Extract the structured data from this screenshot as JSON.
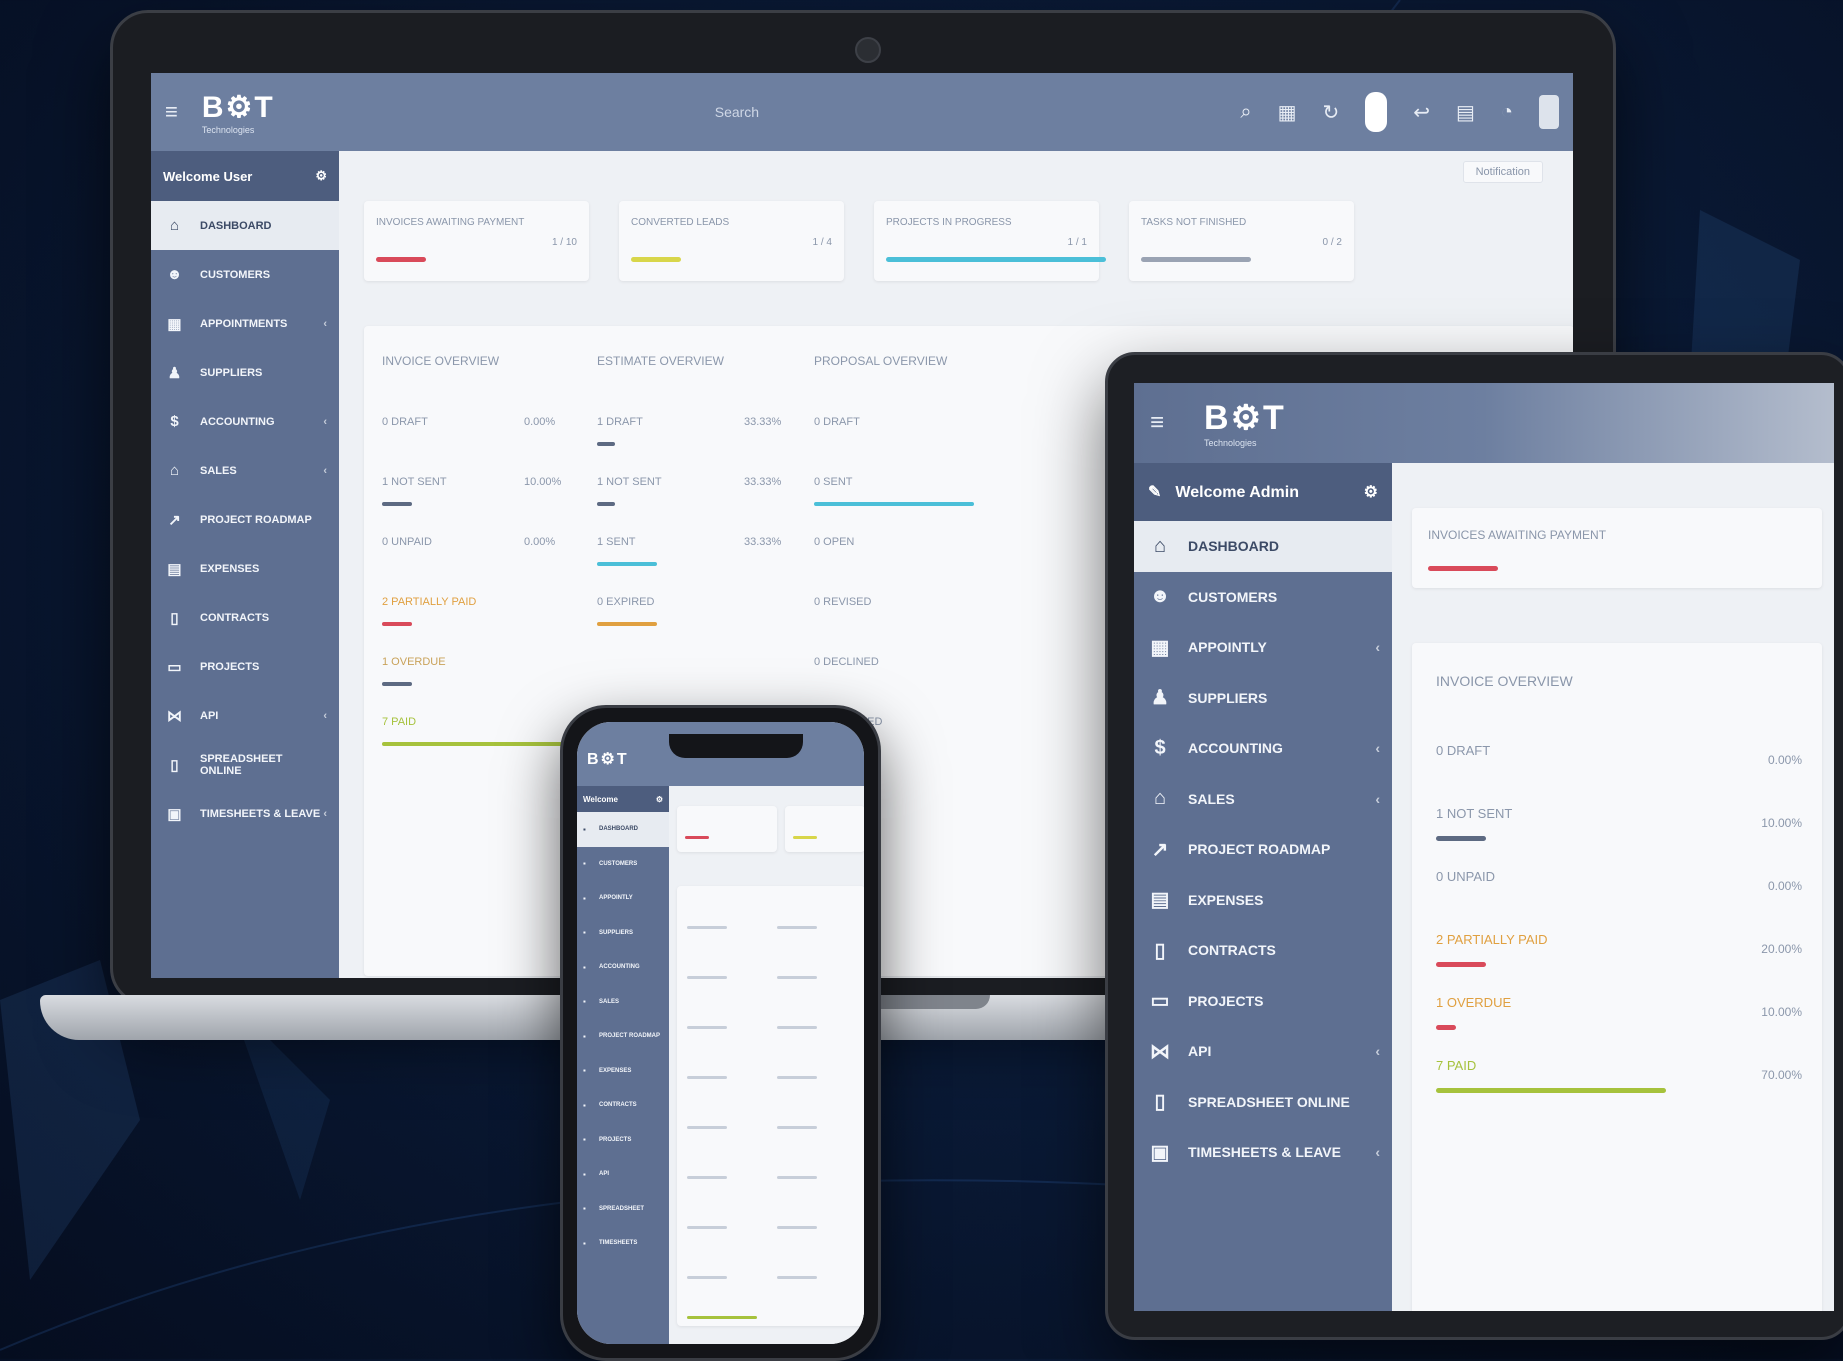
{
  "brand": {
    "logo_text": "B⚙T",
    "logo_sub": "Technologies"
  },
  "colors": {
    "sidebar": "#5e6f91",
    "topbar": "#6d7fa0",
    "accent_red": "#d94a5a",
    "accent_cyan": "#4bbfd8",
    "accent_yellow": "#d8d64a",
    "accent_orange": "#e0a040",
    "accent_green": "#a6c23c"
  },
  "laptop": {
    "search_placeholder": "Search",
    "welcome": "Welcome User",
    "top_button": "Notification",
    "nav": [
      {
        "label": "DASHBOARD",
        "icon": "home-icon",
        "chevron": false,
        "active": true
      },
      {
        "label": "CUSTOMERS",
        "icon": "users-icon",
        "chevron": false
      },
      {
        "label": "APPOINTMENTS",
        "icon": "calendar-icon",
        "chevron": true
      },
      {
        "label": "SUPPLIERS",
        "icon": "user-icon",
        "chevron": false
      },
      {
        "label": "ACCOUNTING",
        "icon": "dollar-icon",
        "chevron": true
      },
      {
        "label": "SALES",
        "icon": "bank-icon",
        "chevron": true
      },
      {
        "label": "PROJECT ROADMAP",
        "icon": "chart-icon",
        "chevron": false
      },
      {
        "label": "EXPENSES",
        "icon": "receipt-icon",
        "chevron": false
      },
      {
        "label": "CONTRACTS",
        "icon": "document-icon",
        "chevron": false
      },
      {
        "label": "PROJECTS",
        "icon": "folder-icon",
        "chevron": false
      },
      {
        "label": "API",
        "icon": "share-icon",
        "chevron": true
      },
      {
        "label": "SPREADSHEET ONLINE",
        "icon": "sheet-icon",
        "chevron": false
      },
      {
        "label": "TIMESHEETS & LEAVE",
        "icon": "briefcase-icon",
        "chevron": true
      }
    ],
    "stat_cards": [
      {
        "title": "INVOICES AWAITING PAYMENT",
        "value": "1 / 10"
      },
      {
        "title": "CONVERTED LEADS",
        "value": "1 / 4"
      },
      {
        "title": "PROJECTS IN PROGRESS",
        "value": "1 / 1"
      },
      {
        "title": "TASKS NOT FINISHED",
        "value": "0 / 2"
      }
    ],
    "overview_cols": [
      "INVOICE OVERVIEW",
      "ESTIMATE OVERVIEW",
      "PROPOSAL OVERVIEW"
    ],
    "overview_rows": [
      [
        "0 DRAFT",
        "0.00%",
        "1 DRAFT",
        "33.33%",
        "0 DRAFT"
      ],
      [
        "1 NOT SENT",
        "10.00%",
        "1 NOT SENT",
        "33.33%",
        "0 SENT"
      ],
      [
        "0 UNPAID",
        "0.00%",
        "1 SENT",
        "33.33%",
        "0 OPEN"
      ],
      [
        "2 PARTIALLY PAID",
        "",
        "0 EXPIRED",
        "",
        "0 REVISED"
      ],
      [
        "1 OVERDUE",
        "",
        "",
        "",
        "0 DECLINED"
      ],
      [
        "7 PAID",
        "",
        "",
        "",
        "0 ACCEPTED"
      ]
    ]
  },
  "tablet": {
    "welcome": "Welcome Admin",
    "nav": [
      {
        "label": "DASHBOARD",
        "icon": "home-icon",
        "chevron": false,
        "active": true
      },
      {
        "label": "CUSTOMERS",
        "icon": "users-icon",
        "chevron": false
      },
      {
        "label": "APPOINTLY",
        "icon": "calendar-icon",
        "chevron": true
      },
      {
        "label": "SUPPLIERS",
        "icon": "user-icon",
        "chevron": false
      },
      {
        "label": "ACCOUNTING",
        "icon": "dollar-icon",
        "chevron": true
      },
      {
        "label": "SALES",
        "icon": "bank-icon",
        "chevron": true
      },
      {
        "label": "PROJECT ROADMAP",
        "icon": "chart-icon",
        "chevron": false
      },
      {
        "label": "EXPENSES",
        "icon": "receipt-icon",
        "chevron": false
      },
      {
        "label": "CONTRACTS",
        "icon": "document-icon",
        "chevron": false
      },
      {
        "label": "PROJECTS",
        "icon": "folder-icon",
        "chevron": false
      },
      {
        "label": "API",
        "icon": "share-icon",
        "chevron": true
      },
      {
        "label": "SPREADSHEET ONLINE",
        "icon": "sheet-icon",
        "chevron": false
      },
      {
        "label": "TIMESHEETS & LEAVE",
        "icon": "briefcase-icon",
        "chevron": true
      }
    ],
    "card_title": "INVOICES AWAITING PAYMENT",
    "overview_title": "INVOICE OVERVIEW",
    "rows": [
      {
        "label": "0 DRAFT",
        "value": "0.00%"
      },
      {
        "label": "1 NOT SENT",
        "value": "10.00%"
      },
      {
        "label": "0 UNPAID",
        "value": "0.00%"
      },
      {
        "label": "2 PARTIALLY PAID",
        "value": "20.00%"
      },
      {
        "label": "1 OVERDUE",
        "value": "10.00%"
      },
      {
        "label": "7 PAID",
        "value": "70.00%"
      }
    ]
  },
  "phone": {
    "welcome": "Welcome",
    "nav": [
      "DASHBOARD",
      "CUSTOMERS",
      "APPOINTLY",
      "SUPPLIERS",
      "ACCOUNTING",
      "SALES",
      "PROJECT ROADMAP",
      "EXPENSES",
      "CONTRACTS",
      "PROJECTS",
      "API",
      "SPREADSHEET",
      "TIMESHEETS"
    ]
  }
}
